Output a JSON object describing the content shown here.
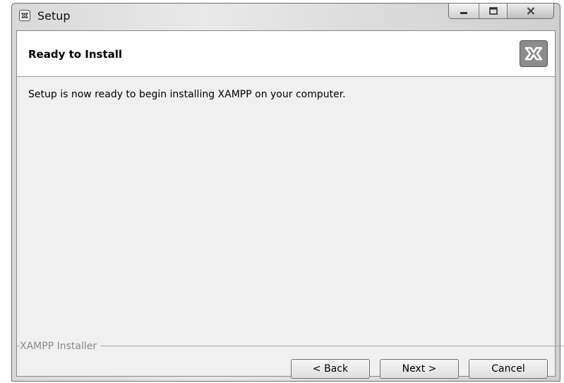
{
  "window": {
    "title": "Setup",
    "icon": "xampp-icon"
  },
  "caption_buttons": {
    "minimize_icon": "minimize-icon",
    "maximize_icon": "maximize-icon",
    "close_icon": "close-icon"
  },
  "header": {
    "title": "Ready to Install",
    "logo": "xampp-logo"
  },
  "body": {
    "message": "Setup is now ready to begin installing XAMPP on your computer."
  },
  "footer": {
    "group_label": "XAMPP Installer",
    "back_label": "< Back",
    "next_label": "Next >",
    "cancel_label": "Cancel"
  },
  "colors": {
    "frame": "#d9d9d9",
    "header_bg": "#ffffff",
    "client_bg": "#f0f0f0",
    "logo_bg": "#8c8c8c"
  }
}
